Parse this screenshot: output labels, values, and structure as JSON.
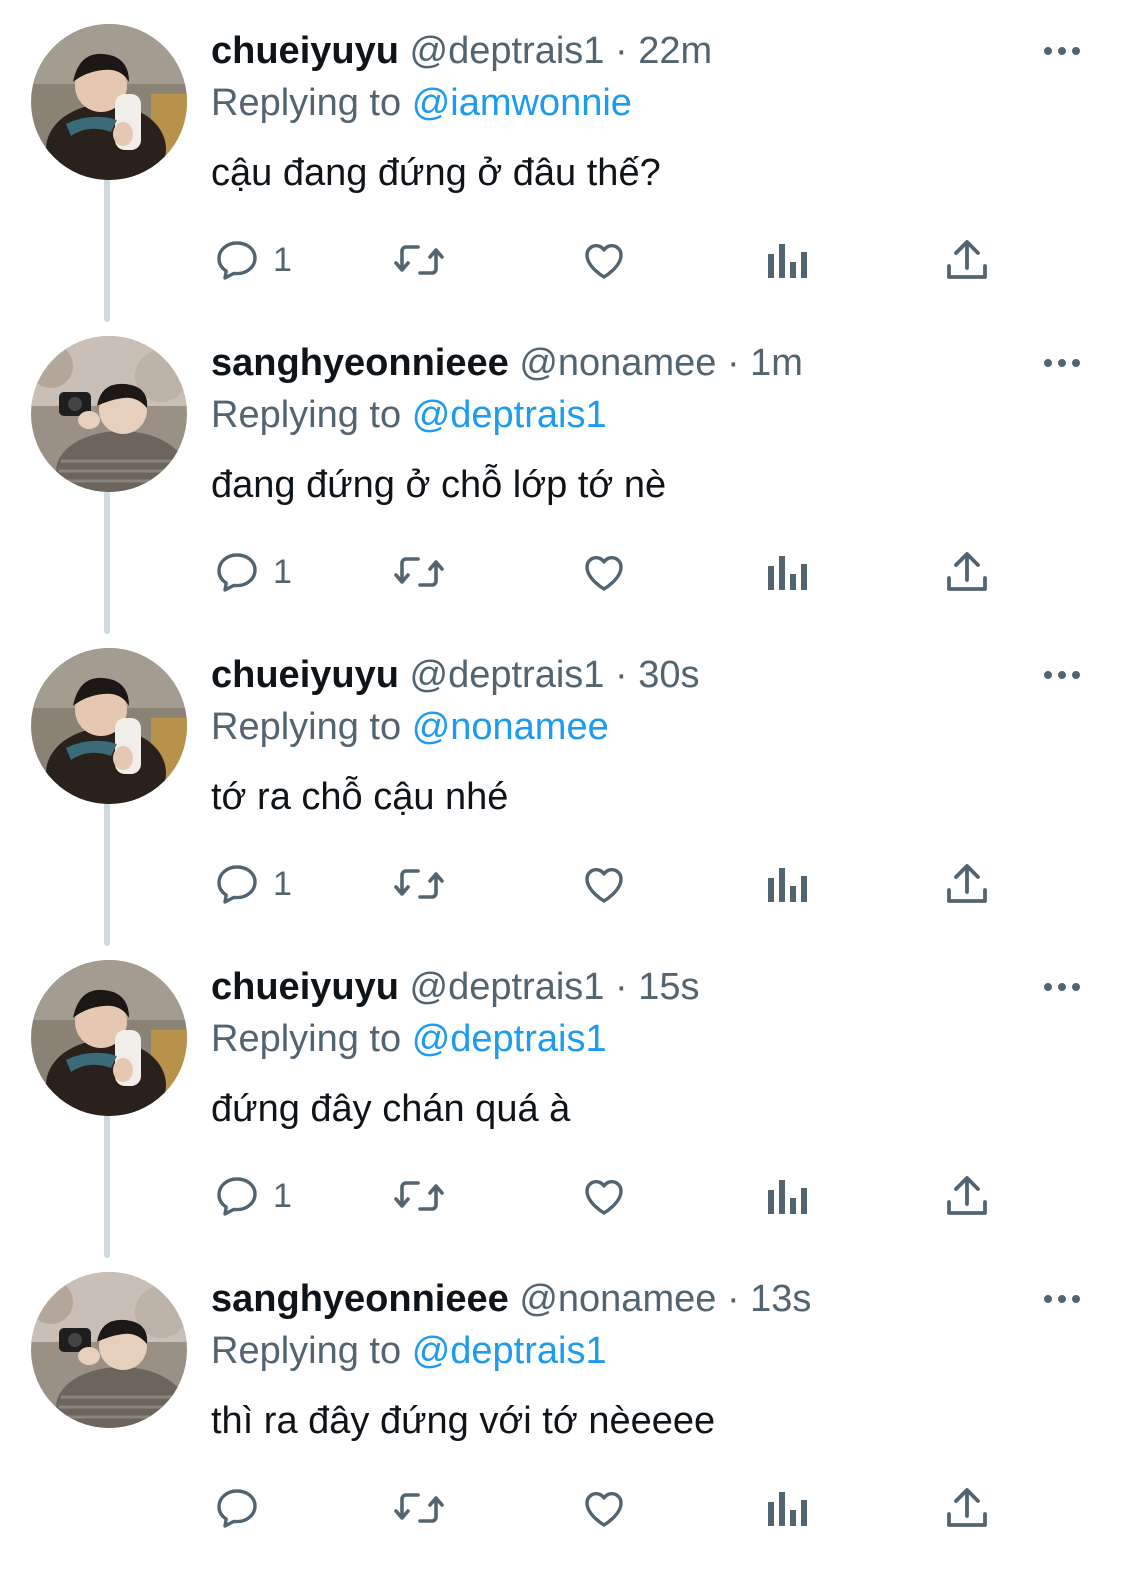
{
  "tweets": [
    {
      "display_name": "chueiyuyu",
      "handle": "@deptrais1",
      "dot": "·",
      "time": "22m",
      "replying_prefix": "Replying to",
      "replying_to": "@iamwonnie",
      "text": "cậu đang đứng ở đâu thế?",
      "reply_count": "1",
      "avatar": "avatar-chueiyuyu"
    },
    {
      "display_name": "sanghyeonnieee",
      "handle": "@nonamee",
      "dot": "·",
      "time": "1m",
      "replying_prefix": "Replying to",
      "replying_to": "@deptrais1",
      "text": "đang đứng ở chỗ lớp tớ nè",
      "reply_count": "1",
      "avatar": "avatar-sanghyeonnieee"
    },
    {
      "display_name": "chueiyuyu",
      "handle": "@deptrais1",
      "dot": "·",
      "time": "30s",
      "replying_prefix": "Replying to",
      "replying_to": "@nonamee",
      "text": "tớ ra chỗ cậu nhé",
      "reply_count": "1",
      "avatar": "avatar-chueiyuyu"
    },
    {
      "display_name": "chueiyuyu",
      "handle": "@deptrais1",
      "dot": "·",
      "time": "15s",
      "replying_prefix": "Replying to",
      "replying_to": "@deptrais1",
      "text": "đứng đây chán quá à",
      "reply_count": "1",
      "avatar": "avatar-chueiyuyu"
    },
    {
      "display_name": "sanghyeonnieee",
      "handle": "@nonamee",
      "dot": "·",
      "time": "13s",
      "replying_prefix": "Replying to",
      "replying_to": "@deptrais1",
      "text": "thì ra đây đứng với tớ nèeeee",
      "reply_count": "",
      "avatar": "avatar-sanghyeonnieee"
    }
  ],
  "icons": {
    "reply": "reply-icon",
    "retweet": "retweet-icon",
    "like": "heart-icon",
    "views": "views-icon",
    "share": "share-icon",
    "more": "more-icon"
  },
  "colors": {
    "text_primary": "#0f1419",
    "text_secondary": "#536471",
    "mention": "#1d9bf0",
    "thread_line": "#cfd9de",
    "icon": "#536471"
  }
}
